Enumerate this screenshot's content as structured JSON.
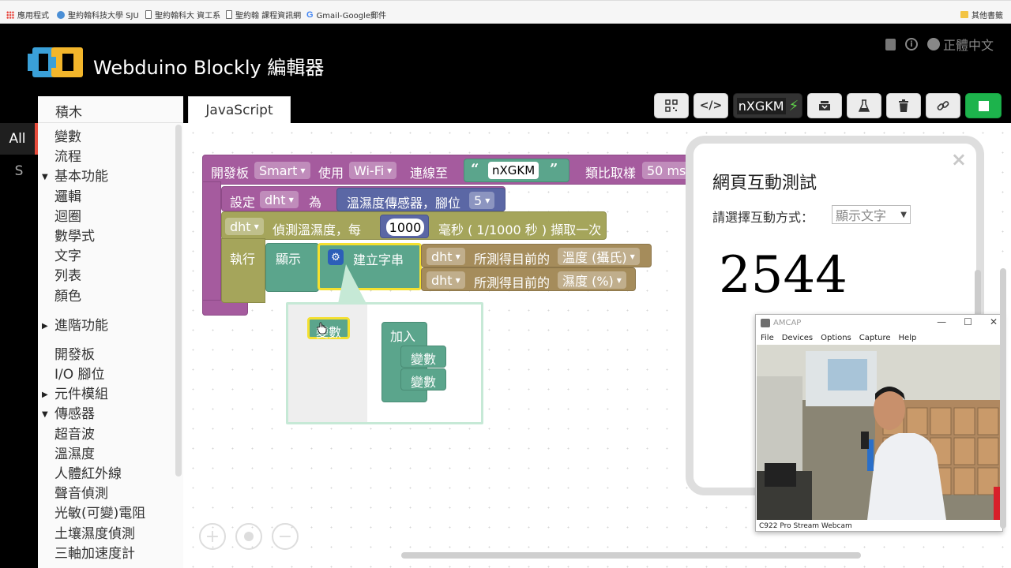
{
  "bookmarks": [
    {
      "icon": "apps-icon",
      "label": "應用程式"
    },
    {
      "icon": "globe-icon",
      "label": "聖約翰科技大學 SJU"
    },
    {
      "icon": "page-icon",
      "label": "聖約翰科大 資工系"
    },
    {
      "icon": "page-icon",
      "label": "聖約翰 課程資訊網"
    },
    {
      "icon": "google-icon",
      "label": "Gmail-Google郵件"
    },
    {
      "icon": "folder-icon",
      "label": "其他書籤"
    }
  ],
  "header": {
    "title": "Webduino Blockly 編輯器",
    "language": "正體中文",
    "brand_colors": {
      "blue": "#3aa0d8",
      "yellow": "#f3b62b"
    }
  },
  "category_strip": {
    "all": "All",
    "s": "S",
    "accent": "#e74c3c"
  },
  "toolbox": {
    "heading": "積木",
    "items": [
      {
        "label": "變數",
        "arrow": "",
        "gap": false
      },
      {
        "label": "流程",
        "arrow": "",
        "gap": false
      },
      {
        "label": "基本功能",
        "arrow": "▼",
        "gap": false
      },
      {
        "label": "邏輯",
        "arrow": "",
        "gap": false
      },
      {
        "label": "迴圈",
        "arrow": "",
        "gap": false
      },
      {
        "label": "數學式",
        "arrow": "",
        "gap": false
      },
      {
        "label": "文字",
        "arrow": "",
        "gap": false
      },
      {
        "label": "列表",
        "arrow": "",
        "gap": false
      },
      {
        "label": "顏色",
        "arrow": "",
        "gap": false
      },
      {
        "label": "進階功能",
        "arrow": "▶",
        "gap": true
      },
      {
        "label": "開發板",
        "arrow": "",
        "gap": true
      },
      {
        "label": "I/O 腳位",
        "arrow": "",
        "gap": false
      },
      {
        "label": "元件模組",
        "arrow": "▶",
        "gap": false
      },
      {
        "label": "傳感器",
        "arrow": "▼",
        "gap": false
      },
      {
        "label": "超音波",
        "arrow": "",
        "gap": false
      },
      {
        "label": "溫濕度",
        "arrow": "",
        "gap": false
      },
      {
        "label": "人體紅外線",
        "arrow": "",
        "gap": false
      },
      {
        "label": "聲音偵測",
        "arrow": "",
        "gap": false
      },
      {
        "label": "光敏(可變)電阻",
        "arrow": "",
        "gap": false
      },
      {
        "label": "土壤濕度偵測",
        "arrow": "",
        "gap": false
      },
      {
        "label": "三軸加速度計",
        "arrow": "",
        "gap": false
      }
    ]
  },
  "tab": {
    "label": "JavaScript"
  },
  "toolbar": {
    "device_id": "nXGKM",
    "buttons": [
      "qr-code-icon",
      "code-icon",
      "device-connect",
      "download-icon",
      "flask-icon",
      "trash-icon",
      "link-icon",
      "stop-icon"
    ]
  },
  "blocks": {
    "board": {
      "prefix": "開發板",
      "board_type": "Smart",
      "use": "使用",
      "conn": "Wi-Fi",
      "connect_to": "連線至",
      "open_quote": "“",
      "device": "nXGKM",
      "close_quote": "”",
      "sampling": "類比取樣",
      "sampling_value": "50 ms"
    },
    "set_dht": {
      "prefix": "設定",
      "var": "dht",
      "as": "為",
      "sensor": "溫濕度傳感器，腳位",
      "pin": "5"
    },
    "detect": {
      "var": "dht",
      "text1": "偵測溫濕度，每",
      "interval": "1000",
      "text2": "毫秒 ( 1/1000 秒 ) 擷取一次"
    },
    "do_label": "執行",
    "show": {
      "label": "顯示",
      "create": "建立字串"
    },
    "temp": {
      "var": "dht",
      "text": "所測得目前的",
      "field": "溫度 (攝氏)"
    },
    "humid": {
      "var": "dht",
      "text": "所測得目前的",
      "field": "濕度 (%)"
    },
    "mutator": {
      "var_item": "變數",
      "join": "加入",
      "item1": "變數",
      "item2": "變數"
    }
  },
  "dialog": {
    "title": "網頁互動測試",
    "mode_label": "請選擇互動方式：",
    "mode_value": "顯示文字",
    "value": "2544",
    "close": "×"
  },
  "amcap": {
    "title": "AMCAP",
    "menu": [
      "File",
      "Devices",
      "Options",
      "Capture",
      "Help"
    ],
    "status": "C922 Pro Stream Webcam"
  }
}
